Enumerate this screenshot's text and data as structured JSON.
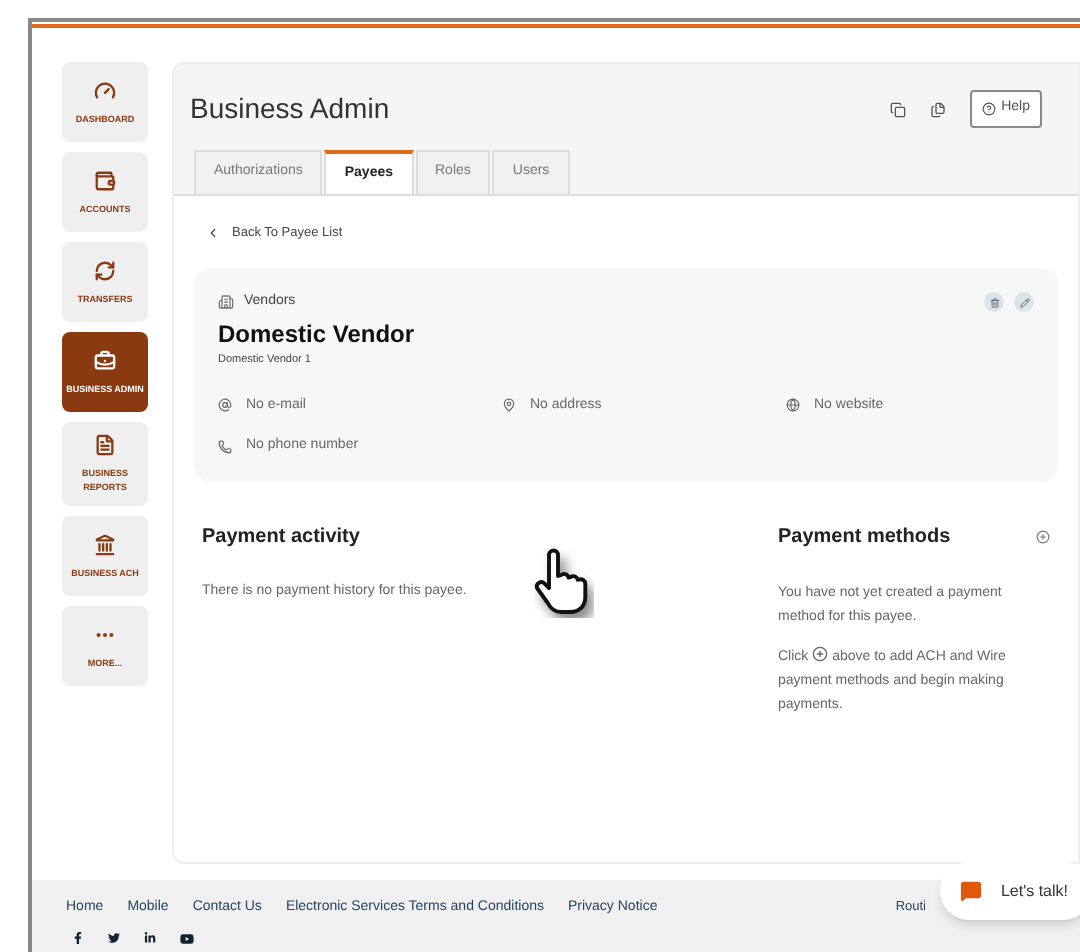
{
  "sidebar": {
    "items": [
      {
        "label": "DASHBOARD",
        "selected": false
      },
      {
        "label": "ACCOUNTS",
        "selected": false
      },
      {
        "label": "TRANSFERS",
        "selected": false
      },
      {
        "label": "BUSINESS ADMIN",
        "selected": true
      },
      {
        "label": "BUSINESS REPORTS",
        "selected": false
      },
      {
        "label": "BUSINESS ACH",
        "selected": false
      },
      {
        "label": "MORE...",
        "selected": false
      }
    ]
  },
  "header": {
    "title": "Business Admin",
    "help": "Help"
  },
  "tabs": [
    {
      "label": "Authorizations",
      "selected": false
    },
    {
      "label": "Payees",
      "selected": true
    },
    {
      "label": "Roles",
      "selected": false
    },
    {
      "label": "Users",
      "selected": false
    }
  ],
  "back_link": "Back To Payee List",
  "payee": {
    "category": "Vendors",
    "name": "Domestic Vendor",
    "subtitle": "Domestic Vendor 1",
    "email": "No e-mail",
    "address": "No address",
    "website": "No website",
    "phone": "No phone number"
  },
  "payment_activity": {
    "title": "Payment activity",
    "message": "There is no payment history for this payee."
  },
  "payment_methods": {
    "title": "Payment methods",
    "message": "You have not yet created a payment method for this payee.",
    "hint_prefix": "Click",
    "hint_suffix": "above to add ACH and Wire payment methods and begin making payments."
  },
  "footer": {
    "links": [
      "Home",
      "Mobile",
      "Contact Us",
      "Electronic Services Terms and Conditions",
      "Privacy Notice"
    ],
    "routing": "Routi"
  },
  "chat": {
    "label": "Let's talk!"
  }
}
